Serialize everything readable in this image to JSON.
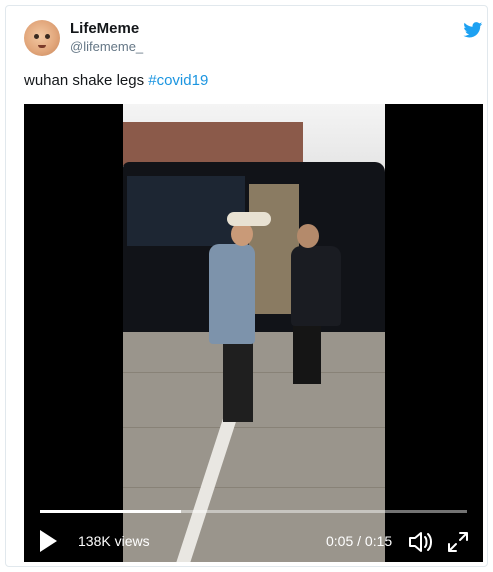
{
  "tweet": {
    "author_name": "LifeMeme",
    "author_handle": "@lifememe_",
    "text_plain": "wuhan shake legs ",
    "hashtag": "#covid19"
  },
  "video": {
    "views": "138K views",
    "time": "0:05 / 0:15",
    "progress_fraction": 0.33
  },
  "icons": {
    "brand": "twitter-bird-icon",
    "play": "play-icon",
    "volume": "volume-icon",
    "fullscreen": "expand-icon"
  },
  "colors": {
    "brand_blue": "#1da1f2",
    "hashtag": "#1b95e0",
    "text": "#14171a",
    "muted": "#657786"
  }
}
